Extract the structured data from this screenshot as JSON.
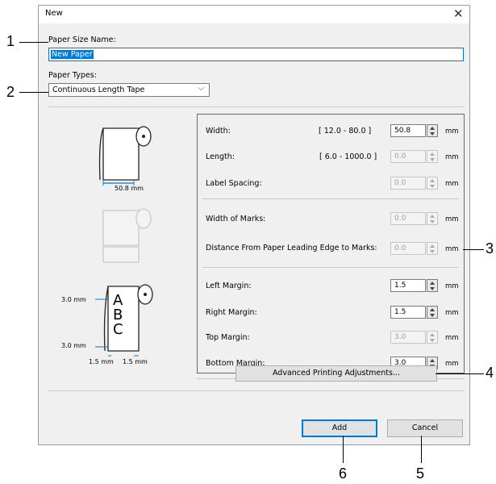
{
  "dialog": {
    "title": "New",
    "paper_size_name_label": "Paper Size Name:",
    "paper_size_name_value": "New Paper",
    "paper_types_label": "Paper Types:",
    "paper_type_selected": "Continuous Length Tape"
  },
  "settings": {
    "width": {
      "label": "Width:",
      "range": "[ 12.0 - 80.0 ]",
      "value": "50.8",
      "unit": "mm",
      "enabled": true
    },
    "length": {
      "label": "Length:",
      "range": "[ 6.0 - 1000.0 ]",
      "value": "0.0",
      "unit": "mm",
      "enabled": false
    },
    "label_spacing": {
      "label": "Label Spacing:",
      "value": "0.0",
      "unit": "mm",
      "enabled": false
    },
    "width_of_marks": {
      "label": "Width of Marks:",
      "value": "0.0",
      "unit": "mm",
      "enabled": false
    },
    "distance_marks": {
      "label": "Distance From Paper Leading Edge to Marks:",
      "value": "0.0",
      "unit": "mm",
      "enabled": false
    },
    "left_margin": {
      "label": "Left Margin:",
      "value": "1.5",
      "unit": "mm",
      "enabled": true
    },
    "right_margin": {
      "label": "Right Margin:",
      "value": "1.5",
      "unit": "mm",
      "enabled": true
    },
    "top_margin": {
      "label": "Top Margin:",
      "value": "3.0",
      "unit": "mm",
      "enabled": false
    },
    "bottom_margin": {
      "label": "Bottom Margin:",
      "value": "3.0",
      "unit": "mm",
      "enabled": true
    }
  },
  "illustration": {
    "roll_width": "50.8 mm",
    "top_margin": "3.0 mm",
    "bottom_margin": "3.0 mm",
    "left_margin": "1.5 mm",
    "right_margin": "1.5 mm",
    "abc": [
      "A",
      "B",
      "C"
    ]
  },
  "buttons": {
    "advanced": "Advanced Printing Adjustments...",
    "add": "Add",
    "cancel": "Cancel"
  },
  "callouts": {
    "c1": "1",
    "c2": "2",
    "c3": "3",
    "c4": "4",
    "c5": "5",
    "c6": "6"
  }
}
